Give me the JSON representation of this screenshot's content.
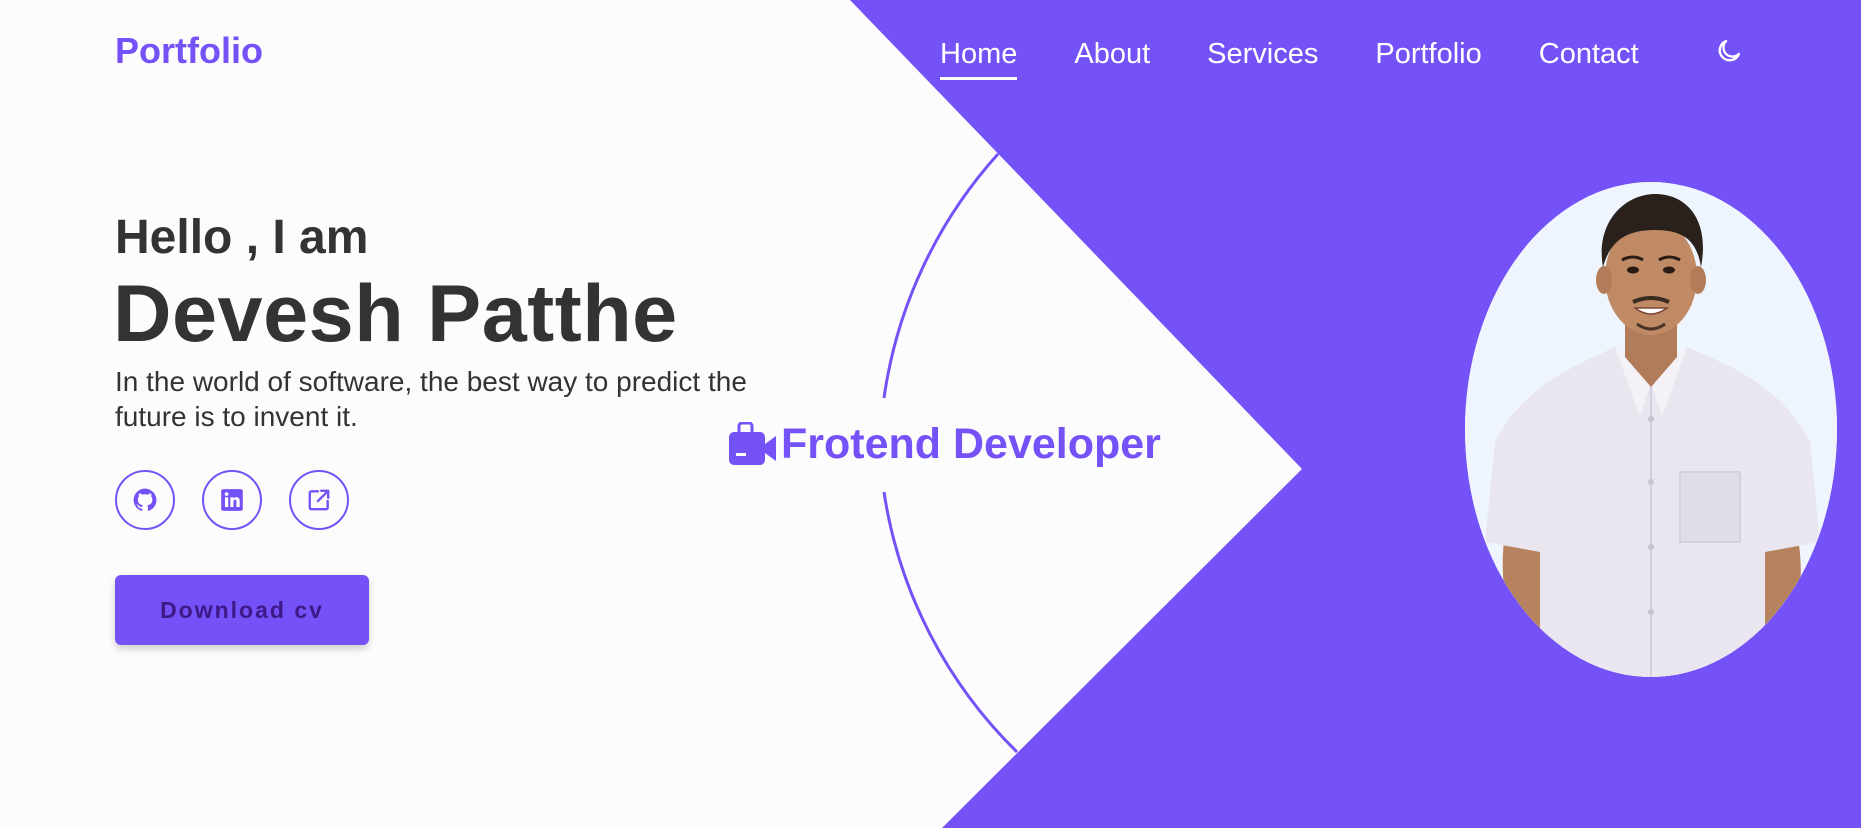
{
  "brand": {
    "logo": "Portfolio",
    "accent_color": "#7551f8",
    "text_color": "#333333",
    "background_color": "#fdfcfd"
  },
  "nav": {
    "items": [
      {
        "label": "Home",
        "active": true
      },
      {
        "label": "About",
        "active": false
      },
      {
        "label": "Services",
        "active": false
      },
      {
        "label": "Portfolio",
        "active": false
      },
      {
        "label": "Contact",
        "active": false
      }
    ],
    "theme_toggle_icon": "moon-icon"
  },
  "hero": {
    "intro": "Hello , I am",
    "name": "Devesh Patthe",
    "tagline": "In the world of software, the best way to predict the future is to invent it.",
    "socials": [
      {
        "name": "github",
        "icon": "github-icon"
      },
      {
        "name": "linkedin",
        "icon": "linkedin-icon"
      },
      {
        "name": "external-link",
        "icon": "external-link-icon"
      }
    ],
    "download_label": "Download cv"
  },
  "role": {
    "icon": "video-camera-icon",
    "label": "Frotend Developer"
  },
  "portrait": {
    "alt": "Portrait photo"
  }
}
